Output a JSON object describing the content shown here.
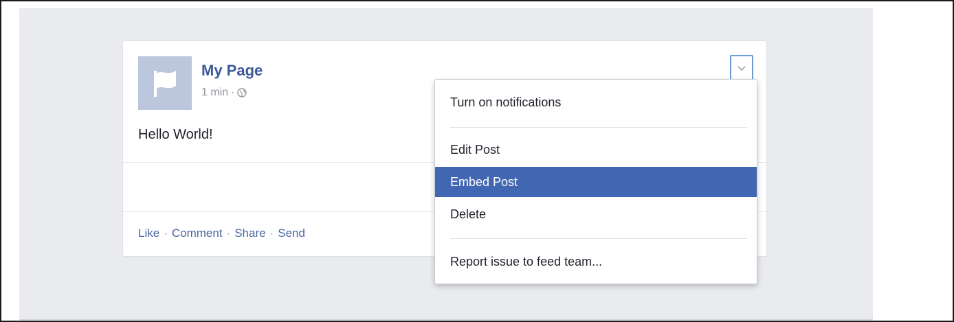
{
  "post": {
    "page_name": "My Page",
    "timestamp": "1 min",
    "meta_separator": "·",
    "text": "Hello World!",
    "actions": [
      {
        "label": "Like"
      },
      {
        "label": "Comment"
      },
      {
        "label": "Share"
      },
      {
        "label": "Send"
      }
    ],
    "action_separator": "·"
  },
  "menu": {
    "items": [
      {
        "label": "Turn on notifications"
      },
      {
        "label": "Edit Post"
      },
      {
        "label": "Embed Post",
        "active": true
      },
      {
        "label": "Delete"
      },
      {
        "label": "Report issue to feed team..."
      }
    ]
  },
  "icons": {
    "avatar": "flag-icon",
    "audience": "globe-icon",
    "menu_toggle": "chevron-down-icon"
  },
  "colors": {
    "brand": "#3b5998",
    "link": "#4b67a1",
    "menu_highlight": "#4267b2",
    "feed_background": "#e9ebee"
  }
}
